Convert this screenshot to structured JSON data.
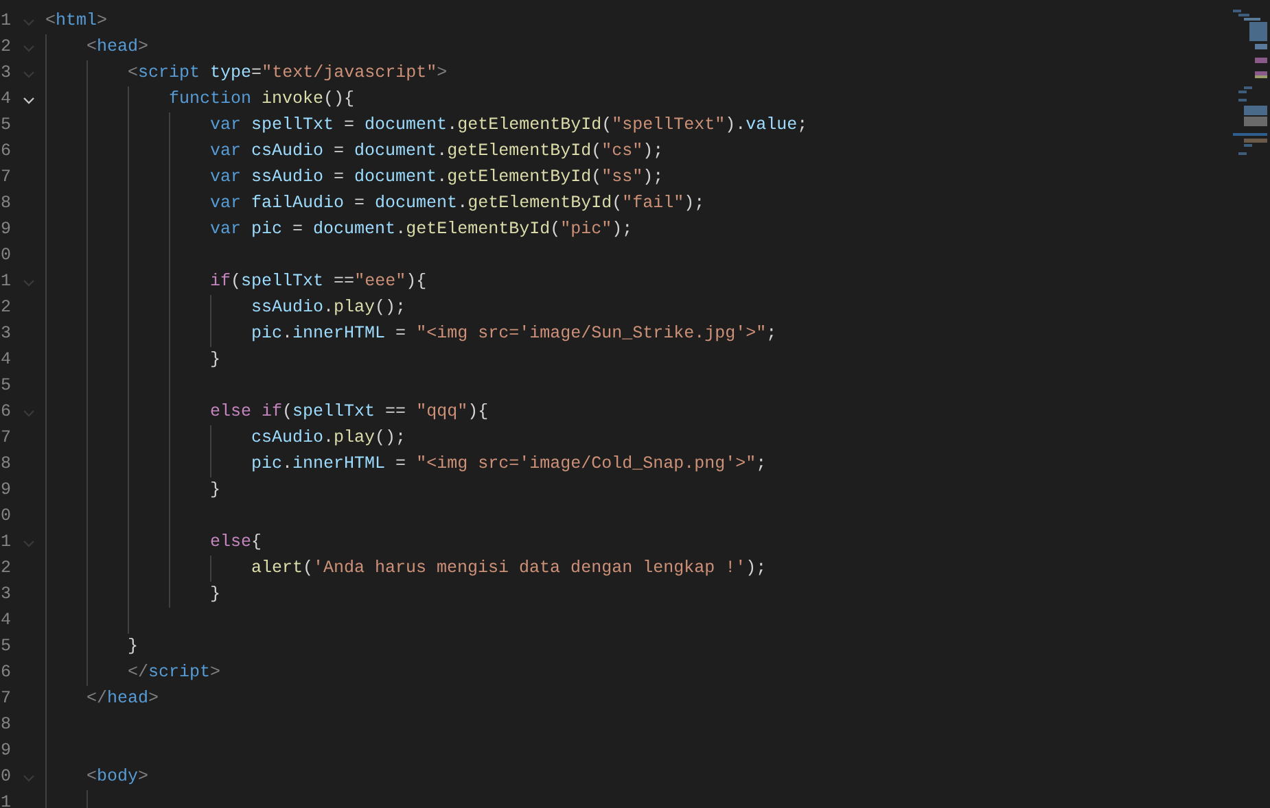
{
  "editor": {
    "lines": [
      {
        "number": "1",
        "fold": true,
        "focused": false,
        "tokens": [
          {
            "kind": "punct",
            "text": "<"
          },
          {
            "kind": "tag",
            "text": "html"
          },
          {
            "kind": "punct",
            "text": ">"
          }
        ],
        "children": [
          {
            "number": "2",
            "fold": true,
            "focused": false,
            "tokens": [
              {
                "kind": "punct",
                "text": "<"
              },
              {
                "kind": "tag",
                "text": "head"
              },
              {
                "kind": "punct",
                "text": ">"
              }
            ],
            "children": [
              {
                "number": "3",
                "fold": true,
                "focused": false,
                "tokens": [
                  {
                    "kind": "punct",
                    "text": "<"
                  },
                  {
                    "kind": "tag",
                    "text": "script "
                  },
                  {
                    "kind": "attr",
                    "text": "type"
                  },
                  {
                    "kind": "plain",
                    "text": "="
                  },
                  {
                    "kind": "str",
                    "text": "\"text/javascript\""
                  },
                  {
                    "kind": "punct",
                    "text": ">"
                  }
                ],
                "children": [
                  {
                    "number": "4",
                    "fold": true,
                    "focused": true,
                    "tokens": [
                      {
                        "kind": "kw",
                        "text": "function "
                      },
                      {
                        "kind": "fn",
                        "text": "invoke"
                      },
                      {
                        "kind": "plain",
                        "text": "(){"
                      }
                    ],
                    "children": [
                      {
                        "number": "5",
                        "fold": false,
                        "tokens": [
                          {
                            "kind": "kw",
                            "text": "var "
                          },
                          {
                            "kind": "var",
                            "text": "spellTxt"
                          },
                          {
                            "kind": "plain",
                            "text": " = "
                          },
                          {
                            "kind": "var",
                            "text": "document"
                          },
                          {
                            "kind": "plain",
                            "text": "."
                          },
                          {
                            "kind": "fn",
                            "text": "getElementById"
                          },
                          {
                            "kind": "plain",
                            "text": "("
                          },
                          {
                            "kind": "str",
                            "text": "\"spellText\""
                          },
                          {
                            "kind": "plain",
                            "text": ")."
                          },
                          {
                            "kind": "var",
                            "text": "value"
                          },
                          {
                            "kind": "plain",
                            "text": ";"
                          }
                        ]
                      },
                      {
                        "number": "6",
                        "fold": false,
                        "tokens": [
                          {
                            "kind": "kw",
                            "text": "var "
                          },
                          {
                            "kind": "var",
                            "text": "csAudio"
                          },
                          {
                            "kind": "plain",
                            "text": " = "
                          },
                          {
                            "kind": "var",
                            "text": "document"
                          },
                          {
                            "kind": "plain",
                            "text": "."
                          },
                          {
                            "kind": "fn",
                            "text": "getElementById"
                          },
                          {
                            "kind": "plain",
                            "text": "("
                          },
                          {
                            "kind": "str",
                            "text": "\"cs\""
                          },
                          {
                            "kind": "plain",
                            "text": ");"
                          }
                        ]
                      },
                      {
                        "number": "7",
                        "fold": false,
                        "tokens": [
                          {
                            "kind": "kw",
                            "text": "var "
                          },
                          {
                            "kind": "var",
                            "text": "ssAudio"
                          },
                          {
                            "kind": "plain",
                            "text": " = "
                          },
                          {
                            "kind": "var",
                            "text": "document"
                          },
                          {
                            "kind": "plain",
                            "text": "."
                          },
                          {
                            "kind": "fn",
                            "text": "getElementById"
                          },
                          {
                            "kind": "plain",
                            "text": "("
                          },
                          {
                            "kind": "str",
                            "text": "\"ss\""
                          },
                          {
                            "kind": "plain",
                            "text": ");"
                          }
                        ]
                      },
                      {
                        "number": "8",
                        "fold": false,
                        "tokens": [
                          {
                            "kind": "kw",
                            "text": "var "
                          },
                          {
                            "kind": "var",
                            "text": "failAudio"
                          },
                          {
                            "kind": "plain",
                            "text": " = "
                          },
                          {
                            "kind": "var",
                            "text": "document"
                          },
                          {
                            "kind": "plain",
                            "text": "."
                          },
                          {
                            "kind": "fn",
                            "text": "getElementById"
                          },
                          {
                            "kind": "plain",
                            "text": "("
                          },
                          {
                            "kind": "str",
                            "text": "\"fail\""
                          },
                          {
                            "kind": "plain",
                            "text": ");"
                          }
                        ]
                      },
                      {
                        "number": "9",
                        "fold": false,
                        "tokens": [
                          {
                            "kind": "kw",
                            "text": "var "
                          },
                          {
                            "kind": "var",
                            "text": "pic"
                          },
                          {
                            "kind": "plain",
                            "text": " = "
                          },
                          {
                            "kind": "var",
                            "text": "document"
                          },
                          {
                            "kind": "plain",
                            "text": "."
                          },
                          {
                            "kind": "fn",
                            "text": "getElementById"
                          },
                          {
                            "kind": "plain",
                            "text": "("
                          },
                          {
                            "kind": "str",
                            "text": "\"pic\""
                          },
                          {
                            "kind": "plain",
                            "text": ");"
                          }
                        ]
                      },
                      {
                        "number": "0",
                        "fold": false
                      },
                      {
                        "number": "1",
                        "fold": true,
                        "focused": false,
                        "tokens": [
                          {
                            "kind": "ctrl",
                            "text": "if"
                          },
                          {
                            "kind": "plain",
                            "text": "("
                          },
                          {
                            "kind": "var",
                            "text": "spellTxt"
                          },
                          {
                            "kind": "plain",
                            "text": " =="
                          },
                          {
                            "kind": "str",
                            "text": "\"eee\""
                          },
                          {
                            "kind": "plain",
                            "text": "){"
                          }
                        ],
                        "children": [
                          {
                            "number": "2",
                            "fold": false,
                            "tokens": [
                              {
                                "kind": "var",
                                "text": "ssAudio"
                              },
                              {
                                "kind": "plain",
                                "text": "."
                              },
                              {
                                "kind": "fn",
                                "text": "play"
                              },
                              {
                                "kind": "plain",
                                "text": "();"
                              }
                            ]
                          },
                          {
                            "number": "3",
                            "fold": false,
                            "tokens": [
                              {
                                "kind": "var",
                                "text": "pic"
                              },
                              {
                                "kind": "plain",
                                "text": "."
                              },
                              {
                                "kind": "var",
                                "text": "innerHTML"
                              },
                              {
                                "kind": "plain",
                                "text": " = "
                              },
                              {
                                "kind": "str",
                                "text": "\"<img src='image/Sun_Strike.jpg'>\""
                              },
                              {
                                "kind": "plain",
                                "text": ";"
                              }
                            ]
                          }
                        ]
                      },
                      {
                        "number": "4",
                        "fold": false,
                        "tokens": [
                          {
                            "kind": "plain",
                            "text": "}"
                          }
                        ]
                      },
                      {
                        "number": "5",
                        "fold": false
                      },
                      {
                        "number": "6",
                        "fold": true,
                        "focused": false,
                        "tokens": [
                          {
                            "kind": "ctrl",
                            "text": "else if"
                          },
                          {
                            "kind": "plain",
                            "text": "("
                          },
                          {
                            "kind": "var",
                            "text": "spellTxt"
                          },
                          {
                            "kind": "plain",
                            "text": " == "
                          },
                          {
                            "kind": "str",
                            "text": "\"qqq\""
                          },
                          {
                            "kind": "plain",
                            "text": "){"
                          }
                        ],
                        "children": [
                          {
                            "number": "7",
                            "fold": false,
                            "tokens": [
                              {
                                "kind": "var",
                                "text": "csAudio"
                              },
                              {
                                "kind": "plain",
                                "text": "."
                              },
                              {
                                "kind": "fn",
                                "text": "play"
                              },
                              {
                                "kind": "plain",
                                "text": "();"
                              }
                            ]
                          },
                          {
                            "number": "8",
                            "fold": false,
                            "tokens": [
                              {
                                "kind": "var",
                                "text": "pic"
                              },
                              {
                                "kind": "plain",
                                "text": "."
                              },
                              {
                                "kind": "var",
                                "text": "innerHTML"
                              },
                              {
                                "kind": "plain",
                                "text": " = "
                              },
                              {
                                "kind": "str",
                                "text": "\"<img src='image/Cold_Snap.png'>\""
                              },
                              {
                                "kind": "plain",
                                "text": ";"
                              }
                            ]
                          }
                        ]
                      },
                      {
                        "number": "9",
                        "fold": false,
                        "tokens": [
                          {
                            "kind": "plain",
                            "text": "}"
                          }
                        ]
                      },
                      {
                        "number": "0",
                        "fold": false
                      },
                      {
                        "number": "1",
                        "fold": true,
                        "focused": false,
                        "tokens": [
                          {
                            "kind": "ctrl",
                            "text": "else"
                          },
                          {
                            "kind": "plain",
                            "text": "{"
                          }
                        ],
                        "children": [
                          {
                            "number": "2",
                            "fold": false,
                            "tokens": [
                              {
                                "kind": "fn",
                                "text": "alert"
                              },
                              {
                                "kind": "plain",
                                "text": "("
                              },
                              {
                                "kind": "str",
                                "text": "'Anda harus mengisi data dengan lengkap !'"
                              },
                              {
                                "kind": "plain",
                                "text": ");"
                              }
                            ]
                          }
                        ]
                      },
                      {
                        "number": "3",
                        "fold": false,
                        "tokens": [
                          {
                            "kind": "plain",
                            "text": "}"
                          }
                        ]
                      }
                    ]
                  },
                  {
                    "number": "4",
                    "fold": false
                  }
                ]
              },
              {
                "number": "5",
                "fold": false,
                "tokens": [
                  {
                    "kind": "plain",
                    "text": "}"
                  }
                ]
              },
              {
                "number": "6",
                "fold": false,
                "tokens": [
                  {
                    "kind": "punct",
                    "text": "</"
                  },
                  {
                    "kind": "tag",
                    "text": "script"
                  },
                  {
                    "kind": "punct",
                    "text": ">"
                  }
                ]
              }
            ]
          },
          {
            "number": "7",
            "fold": false,
            "tokens": [
              {
                "kind": "punct",
                "text": "</"
              },
              {
                "kind": "tag",
                "text": "head"
              },
              {
                "kind": "punct",
                "text": ">"
              }
            ]
          },
          {
            "number": "8",
            "fold": false
          },
          {
            "number": "9",
            "fold": false
          },
          {
            "number": "0",
            "fold": true,
            "focused": false,
            "tokens": [
              {
                "kind": "punct",
                "text": "<"
              },
              {
                "kind": "tag",
                "text": "body"
              },
              {
                "kind": "punct",
                "text": ">"
              }
            ],
            "children": [
              {
                "number": "1",
                "fold": false
              }
            ]
          }
        ]
      }
    ]
  }
}
